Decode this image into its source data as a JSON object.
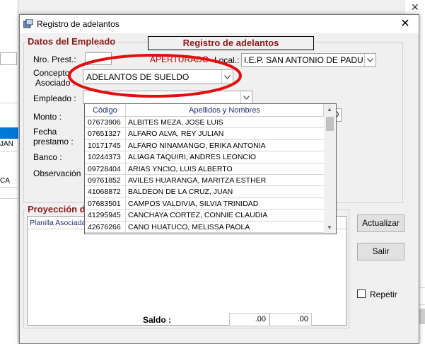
{
  "background": {
    "left_rows": [
      "JAN",
      "CA"
    ]
  },
  "dialog": {
    "title": "Registro de adelantos",
    "close_glyph": "✕",
    "banner": "Registro de adelantos",
    "group_employee": "Datos del Empleado",
    "group_projection": "Proyección d",
    "labels": {
      "nro_prest": "Nro. Prest.:",
      "status": "APERTURADO",
      "local": "Local.:",
      "concepto_line1": "Concepto",
      "concepto_line2": "Asociado :",
      "empleado": "Empleado :",
      "monto": "Monto :",
      "fecha_line1": "Fecha",
      "fecha_line2": "prestamo :",
      "banco": "Banco :",
      "observacion": "Observación",
      "planilla": "Planilla Asociada",
      "saldo": "Saldo :"
    },
    "fields": {
      "local_value": "I.E.P. SAN ANTONIO DE PADUA I",
      "concepto_value": "ADELANTOS DE SUELDO",
      "monto_value_fragment": "0",
      "saldo_1": ".00",
      "saldo_2": ".00"
    },
    "buttons": {
      "actualizar": "Actualizar",
      "salir": "Salir"
    },
    "checkbox_repetir": "Repetir"
  },
  "dropdown": {
    "columns": [
      "Código",
      "Apellidos y Nombres"
    ],
    "rows": [
      [
        "07673906",
        "ALBITES  MEZA, JOSE LUIS"
      ],
      [
        "07651327",
        "ALFARO ALVA, REY JULIAN"
      ],
      [
        "10171745",
        "ALFARO NINAMANGO, ERIKA ANTONIA"
      ],
      [
        "10244373",
        "ALIAGA TAQUIRI, ANDRES LEONCIO"
      ],
      [
        "09728404",
        "ARIAS YNCIO, LUIS  ALBERTO"
      ],
      [
        "09761852",
        "AVILES  HUARANGA, MARITZA ESTHER"
      ],
      [
        "41068872",
        "BALDEON DE LA CRUZ, JUAN"
      ],
      [
        "07683501",
        "CAMPOS VALDIVIA, SILVIA TRINIDAD"
      ],
      [
        "41295945",
        "CANCHAYA CORTEZ, CONNIE CLAUDIA"
      ],
      [
        "42676266",
        "CANO HUATUCO, MELISSA PAOLA"
      ]
    ]
  },
  "colors": {
    "annotation_ellipse": "#e01010",
    "group_label": "#8b1a1a",
    "selection_blue": "#0078d7"
  }
}
